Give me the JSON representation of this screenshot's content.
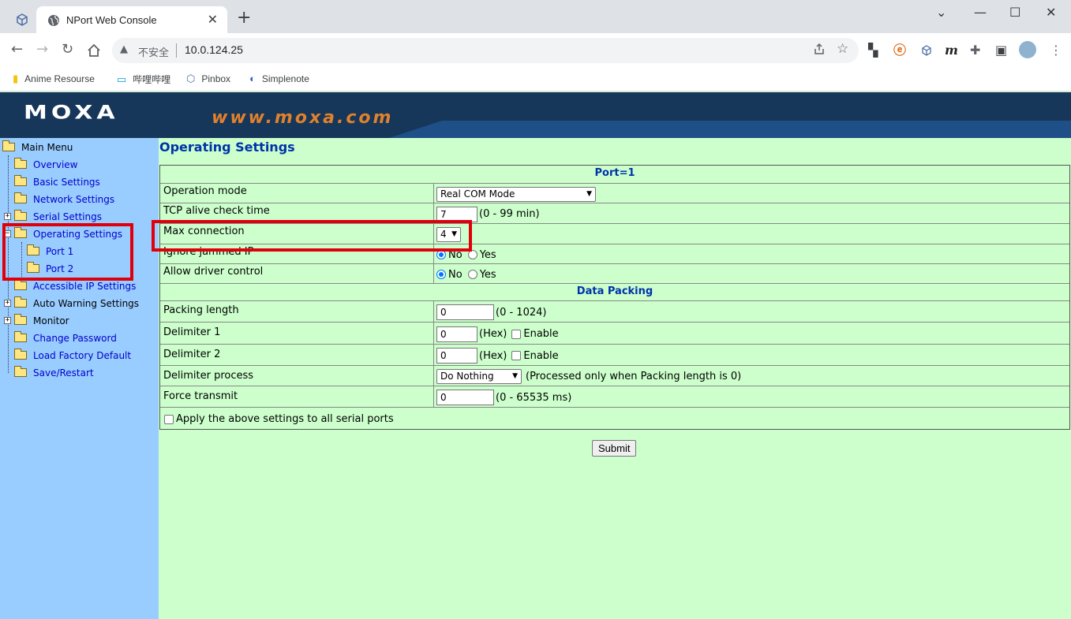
{
  "browser": {
    "tab_title": "NPort Web Console",
    "tab_close": "✕",
    "new_tab": "+",
    "window_controls": [
      "⌄",
      "—",
      "☐",
      "✕"
    ],
    "insecure_label": "不安全",
    "url": "10.0.124.25",
    "bookmarks": [
      "Anime Resourse",
      "哔哩哔哩",
      "Pinbox",
      "Simplenote"
    ]
  },
  "banner": {
    "logo": "MOXA",
    "site": "www.moxa.com"
  },
  "sidebar": {
    "root": "Main Menu",
    "items": {
      "overview": "Overview",
      "basic": "Basic Settings",
      "network": "Network Settings",
      "serial": "Serial Settings",
      "operating": "Operating Settings",
      "port1": "Port 1",
      "port2": "Port 2",
      "accessible": "Accessible IP Settings",
      "autowarning": "Auto Warning Settings",
      "monitor": "Monitor",
      "password": "Change Password",
      "factory": "Load Factory Default",
      "save": "Save/Restart"
    }
  },
  "page": {
    "title": "Operating Settings",
    "port_header": "Port=1",
    "operation_mode_label": "Operation mode",
    "operation_mode_value": "Real COM Mode",
    "tcp_alive_label": "TCP alive check time",
    "tcp_alive_value": "7",
    "tcp_alive_range": "(0 - 99 min)",
    "max_conn_label": "Max connection",
    "max_conn_value": "4",
    "ignore_jammed_label": "Ignore jammed IP",
    "allow_driver_label": "Allow driver control",
    "radio_no": "No",
    "radio_yes": "Yes",
    "data_packing_header": "Data Packing",
    "packing_length_label": "Packing length",
    "packing_length_value": "0",
    "packing_length_range": "(0 - 1024)",
    "delimiter1_label": "Delimiter 1",
    "delimiter1_value": "0",
    "delimiter2_label": "Delimiter 2",
    "delimiter2_value": "0",
    "hex_label": "(Hex)",
    "enable_label": "Enable",
    "delimiter_process_label": "Delimiter process",
    "delimiter_process_value": "Do Nothing",
    "delimiter_process_note": "(Processed only when Packing length is 0)",
    "force_transmit_label": "Force transmit",
    "force_transmit_value": "0",
    "force_transmit_range": "(0 - 65535 ms)",
    "apply_all_label": "Apply the above settings to all serial ports",
    "submit_label": "Submit"
  },
  "colors": {
    "sidebar_bg": "#99ccff",
    "content_bg": "#ccffcc",
    "link": "#0000cc",
    "heading": "#0033aa",
    "highlight": "#e0000c"
  }
}
